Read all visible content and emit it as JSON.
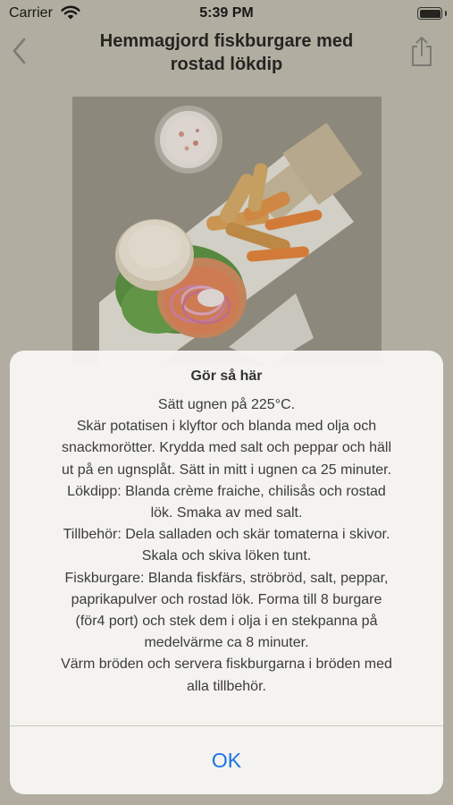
{
  "status_bar": {
    "carrier": "Carrier",
    "time": "5:39 PM"
  },
  "nav": {
    "title_line1": "Hemmagjord fiskburgare med",
    "title_line2": "rostad lökdip"
  },
  "alert": {
    "title": "Gör så här",
    "message_lines": [
      "Sätt ugnen på 225°C.",
      "Skär potatisen i klyftor och blanda med olja och",
      "snackmorötter. Krydda med salt och peppar och häll",
      "ut på en ugnsplåt. Sätt in mitt i ugnen ca 25 minuter.",
      "Lökdipp: Blanda crème fraiche, chilisås och rostad",
      "lök. Smaka av med salt.",
      "Tillbehör: Dela salladen och skär tomaterna i skivor.",
      "Skala och skiva löken tunt.",
      "Fiskburgare: Blanda fiskfärs, ströbröd, salt, peppar,",
      "paprikapulver och rostad lök. Forma till 8 burgare",
      "(för4 port) och stek dem i olja i en stekpanna på",
      "medelvärme ca 8 minuter.",
      "Värm bröden och servera fiskburgarna i bröden med",
      "alla tillbehör."
    ],
    "ok_label": "OK"
  },
  "colors": {
    "accent": "#1a73e8",
    "background": "#bcb8ab",
    "alert_bg": "#f7f6f3"
  },
  "icons": {
    "back": "chevron-left-icon",
    "share": "share-icon",
    "wifi": "wifi-icon",
    "battery": "battery-icon"
  }
}
